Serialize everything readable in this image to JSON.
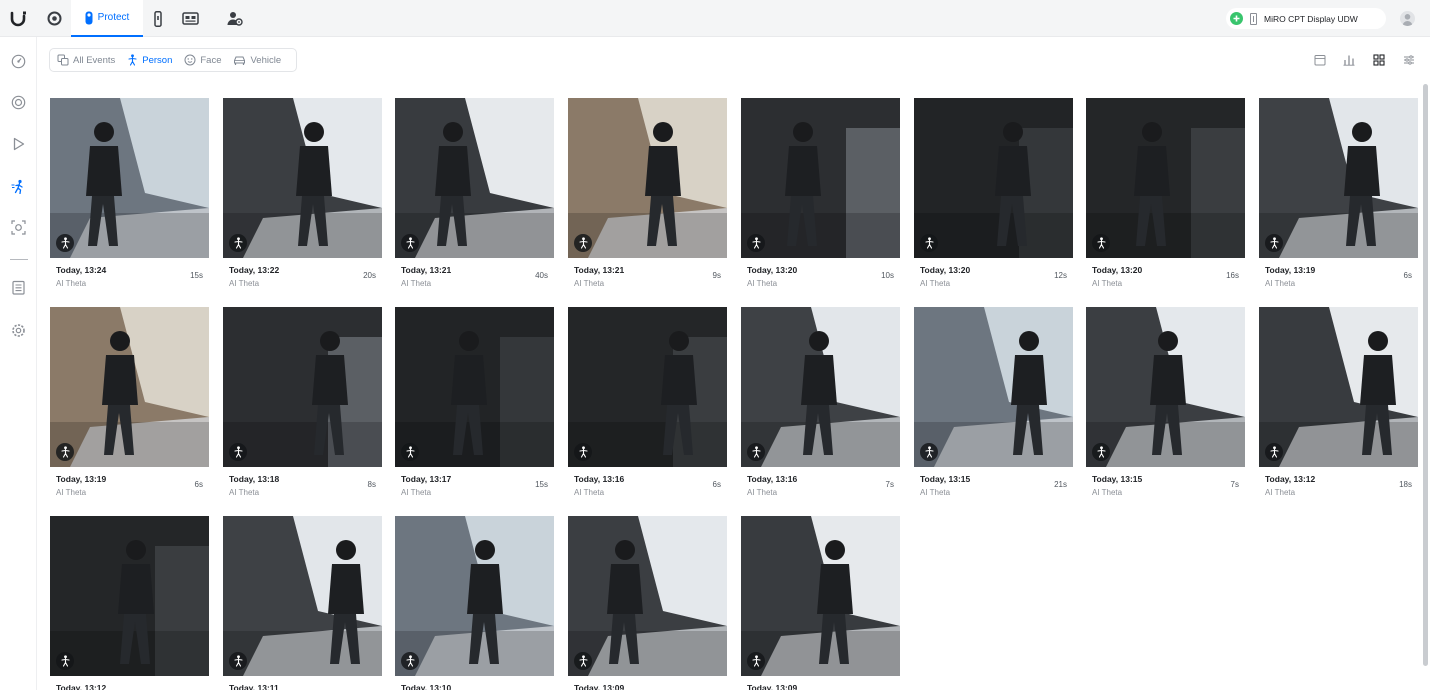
{
  "topbar": {
    "app_label": "Protect",
    "console_name": "MiRO CPT Display UDW",
    "colors": {
      "accent": "#006fff",
      "online": "#39c56d"
    }
  },
  "filters": [
    {
      "label": "All Events",
      "icon": "all-events-icon",
      "active": false
    },
    {
      "label": "Person",
      "icon": "person-icon",
      "active": true
    },
    {
      "label": "Face",
      "icon": "face-icon",
      "active": false
    },
    {
      "label": "Vehicle",
      "icon": "vehicle-icon",
      "active": false
    }
  ],
  "sidebar": [
    "dashboard-icon",
    "cameras-icon",
    "playback-icon",
    "detections-icon",
    "ai-key-icon",
    "logs-icon",
    "settings-icon"
  ],
  "events": [
    {
      "time": "Today, 13:24",
      "camera": "AI Theta",
      "duration": "15s"
    },
    {
      "time": "Today, 13:22",
      "camera": "AI Theta",
      "duration": "20s"
    },
    {
      "time": "Today, 13:21",
      "camera": "AI Theta",
      "duration": "40s"
    },
    {
      "time": "Today, 13:21",
      "camera": "AI Theta",
      "duration": "9s"
    },
    {
      "time": "Today, 13:20",
      "camera": "AI Theta",
      "duration": "10s"
    },
    {
      "time": "Today, 13:20",
      "camera": "AI Theta",
      "duration": "12s"
    },
    {
      "time": "Today, 13:20",
      "camera": "AI Theta",
      "duration": "16s"
    },
    {
      "time": "Today, 13:19",
      "camera": "AI Theta",
      "duration": "6s"
    },
    {
      "time": "Today, 13:19",
      "camera": "AI Theta",
      "duration": "6s"
    },
    {
      "time": "Today, 13:18",
      "camera": "AI Theta",
      "duration": "8s"
    },
    {
      "time": "Today, 13:17",
      "camera": "AI Theta",
      "duration": "15s"
    },
    {
      "time": "Today, 13:16",
      "camera": "AI Theta",
      "duration": "6s"
    },
    {
      "time": "Today, 13:16",
      "camera": "AI Theta",
      "duration": "7s"
    },
    {
      "time": "Today, 13:15",
      "camera": "AI Theta",
      "duration": "21s"
    },
    {
      "time": "Today, 13:15",
      "camera": "AI Theta",
      "duration": "7s"
    },
    {
      "time": "Today, 13:12",
      "camera": "AI Theta",
      "duration": "18s"
    },
    {
      "time": "Today, 13:12",
      "camera": "",
      "duration": ""
    },
    {
      "time": "Today, 13:11",
      "camera": "",
      "duration": ""
    },
    {
      "time": "Today, 13:10",
      "camera": "",
      "duration": ""
    },
    {
      "time": "Today, 13:09",
      "camera": "",
      "duration": ""
    },
    {
      "time": "Today, 13:09",
      "camera": "",
      "duration": ""
    }
  ]
}
